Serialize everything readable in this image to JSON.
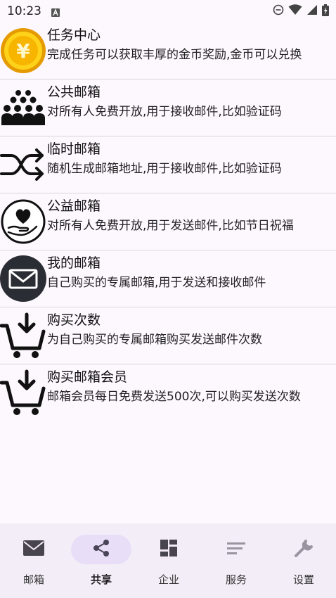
{
  "status_bar": {
    "time": "10:23",
    "notification_icon": "app-notification-icon",
    "system_icons": [
      "do-not-disturb-icon",
      "wifi-icon",
      "cell-signal-icon",
      "battery-charging-icon"
    ]
  },
  "list": [
    {
      "title": "任务中心",
      "desc": "完成任务可以获取丰厚的金币奖励,金币可以兑换",
      "icon": "gold-coin-icon"
    },
    {
      "title": "公共邮箱",
      "desc": "对所有人免费开放,用于接收邮件,比如验证码",
      "icon": "group-people-icon"
    },
    {
      "title": "临时邮箱",
      "desc": "随机生成邮箱地址,用于接收邮件,比如验证码",
      "icon": "shuffle-icon"
    },
    {
      "title": "公益邮箱",
      "desc": "对所有人免费开放,用于发送邮件,比如节日祝福",
      "icon": "heart-hand-icon"
    },
    {
      "title": "我的邮箱",
      "desc": "自己购买的专属邮箱,用于发送和接收邮件",
      "icon": "envelope-circle-icon"
    },
    {
      "title": "购买次数",
      "desc": "为自己购买的专属邮箱购买发送邮件次数",
      "icon": "cart-download-icon"
    },
    {
      "title": "购买邮箱会员",
      "desc": "邮箱会员每日免费发送500次,可以购买发送次数",
      "icon": "cart-download-icon"
    }
  ],
  "nav": [
    {
      "label": "邮箱",
      "icon": "mail-icon",
      "active": false
    },
    {
      "label": "共享",
      "icon": "share-icon",
      "active": true
    },
    {
      "label": "企业",
      "icon": "dashboard-icon",
      "active": false
    },
    {
      "label": "服务",
      "icon": "notes-icon",
      "active": false
    },
    {
      "label": "设置",
      "icon": "wrench-icon",
      "active": false
    }
  ],
  "colors": {
    "background": "#fdf7fe",
    "nav_background": "#f3edf7",
    "nav_active_pill": "#e8def8",
    "coin_gold": "#f5b800",
    "envelope_dark": "#2b2d35"
  }
}
